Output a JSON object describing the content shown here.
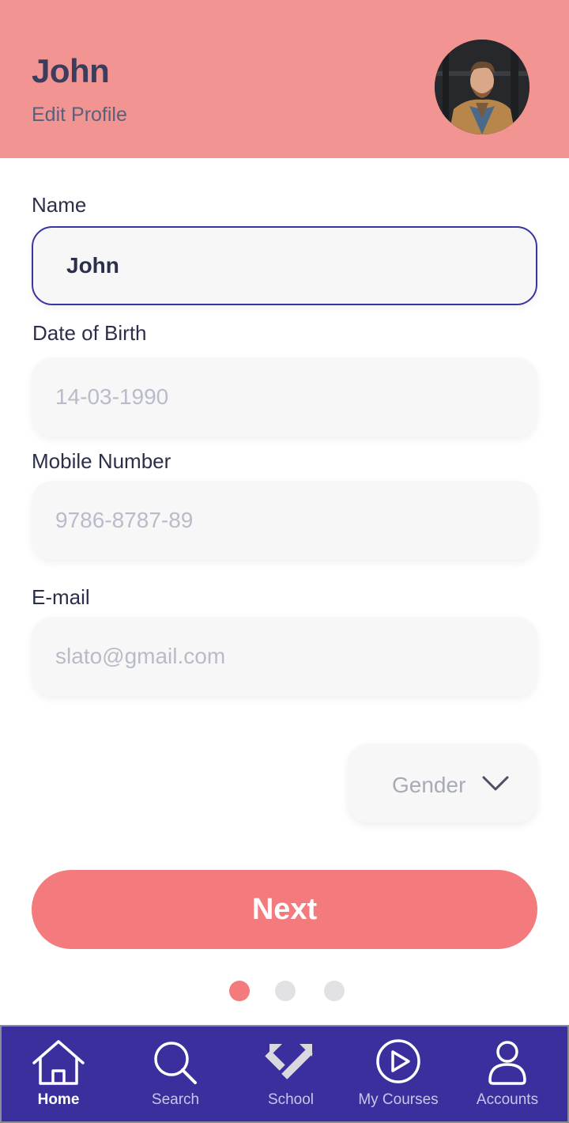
{
  "header": {
    "name": "John",
    "subtitle": "Edit Profile",
    "background": "#f29492"
  },
  "form": {
    "name": {
      "label": "Name",
      "value": "John"
    },
    "dob": {
      "label": "Date of Birth",
      "placeholder": "14-03-1990"
    },
    "mobile": {
      "label": "Mobile Number",
      "placeholder": "9786-8787-89"
    },
    "email": {
      "label": "E-mail",
      "placeholder": "slato@gmail.com"
    },
    "gender": {
      "placeholder": "Gender"
    }
  },
  "next_button": {
    "label": "Next",
    "color": "#f37b7d"
  },
  "pagination": {
    "total": 3,
    "current": 1
  },
  "tabbar": {
    "background": "#3a2f9c",
    "items": [
      {
        "label": "Home",
        "icon": "home-icon",
        "active": true
      },
      {
        "label": "Search",
        "icon": "search-icon",
        "active": false
      },
      {
        "label": "School",
        "icon": "school-arrows-icon",
        "active": false
      },
      {
        "label": "My Courses",
        "icon": "play-circle-icon",
        "active": false
      },
      {
        "label": "Accounts",
        "icon": "user-icon",
        "active": false
      }
    ]
  }
}
